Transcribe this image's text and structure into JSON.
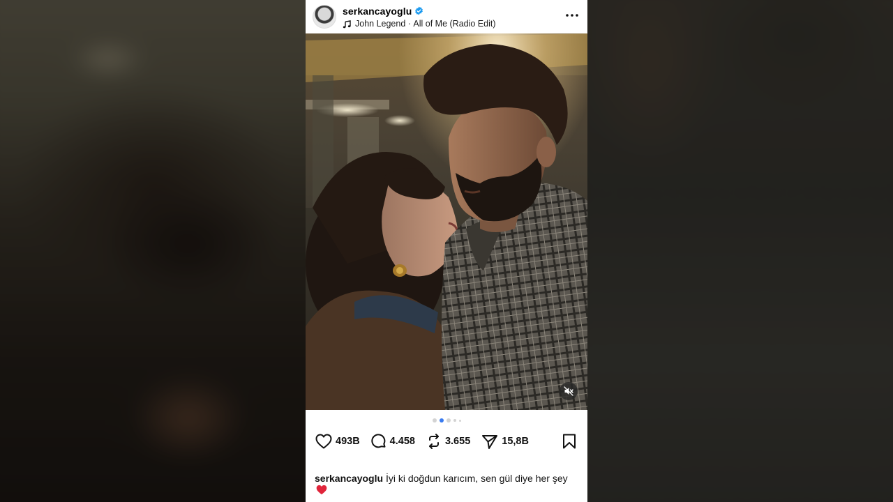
{
  "post": {
    "username": "serkancayoglu",
    "verified": true,
    "music": {
      "artist": "John Legend",
      "separator": " · ",
      "track": "All of Me (Radio Edit)"
    },
    "carousel": {
      "total": 5,
      "active_index": 1
    },
    "actions": {
      "likes": "493B",
      "comments": "4.458",
      "reposts": "3.655",
      "shares": "15,8B"
    },
    "caption": {
      "username": "serkancayoglu",
      "text": " İyi ki doğdun karıcım, sen gül diye her şey"
    }
  },
  "icons": {
    "header": [
      "verified-badge-icon",
      "music-note-icon",
      "more-options-icon"
    ],
    "photo": [
      "mute-icon"
    ],
    "actions": [
      "heart-icon",
      "comment-icon",
      "repost-icon",
      "share-icon",
      "bookmark-icon"
    ],
    "caption": [
      "red-heart-emoji-icon"
    ]
  },
  "colors": {
    "accent": "#3a7bf0",
    "verified": "#1d9bf0",
    "emoji_heart": "#e0243a"
  }
}
